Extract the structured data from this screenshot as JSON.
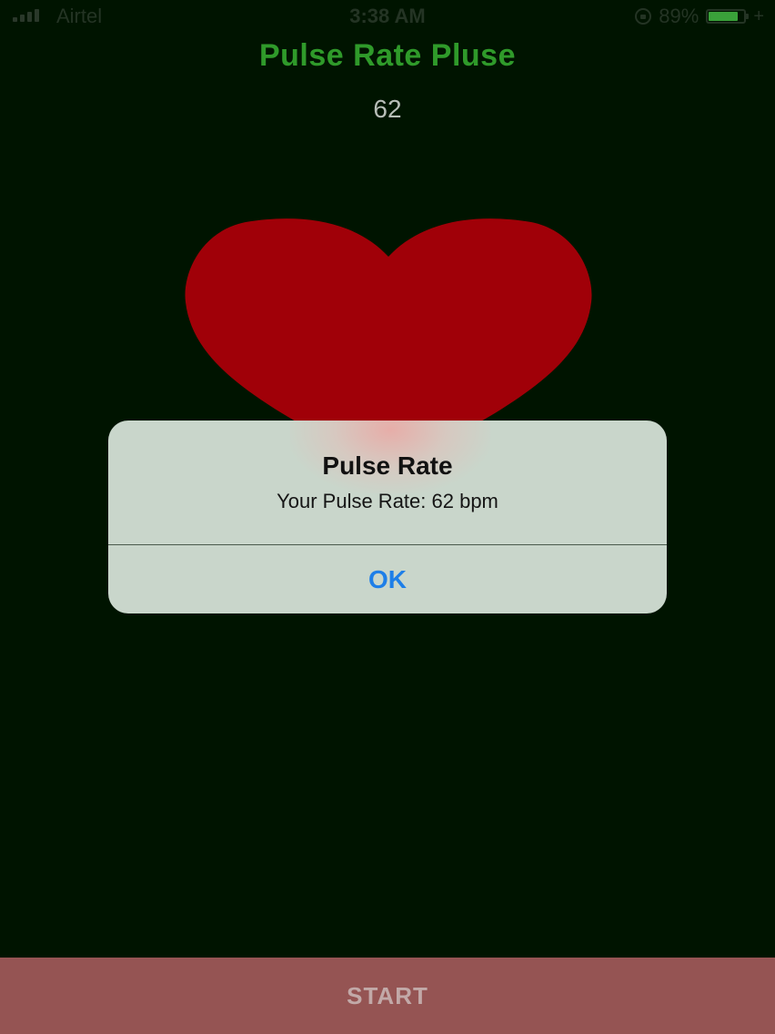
{
  "status_bar": {
    "carrier": "Airtel",
    "time": "3:38 AM",
    "battery_percent": "89%",
    "battery_level": 0.89,
    "icons": [
      "signal-icon",
      "orientation-lock-icon",
      "battery-icon",
      "charging-icon"
    ]
  },
  "header": {
    "title": "Pulse Rate Pluse",
    "rate_value": "62"
  },
  "heart": {
    "color": "#a00008",
    "icon": "heart-icon"
  },
  "alert": {
    "title": "Pulse Rate",
    "message": "Your Pulse Rate: 62 bpm",
    "ok_label": "OK"
  },
  "footer": {
    "start_label": "START"
  },
  "colors": {
    "background": "#001400",
    "title_green": "#2f9a2a",
    "alert_button_blue": "#1e7fe8",
    "start_button_bg": "#955453"
  }
}
